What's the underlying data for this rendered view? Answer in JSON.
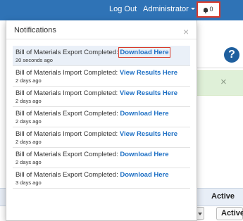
{
  "navbar": {
    "logout_label": "Log Out",
    "user_menu_label": "Administrator",
    "notification_count": "0"
  },
  "background": {
    "help_label": "?",
    "alert_close_label": "×",
    "column_active_header": "Active",
    "active_filter_label": "Active"
  },
  "notifications": {
    "title": "Notifications",
    "close_label": "×",
    "items": [
      {
        "message": "Bill of Materials Export Completed: ",
        "link": "Download Here",
        "time": "20 seconds ago"
      },
      {
        "message": "Bill of Materials Import Completed: ",
        "link": "View Results Here",
        "time": "2 days ago"
      },
      {
        "message": "Bill of Materials Import Completed: ",
        "link": "View Results Here",
        "time": "2 days ago"
      },
      {
        "message": "Bill of Materials Export Completed: ",
        "link": "Download Here",
        "time": "2 days ago"
      },
      {
        "message": "Bill of Materials Import Completed: ",
        "link": "View Results Here",
        "time": "2 days ago"
      },
      {
        "message": "Bill of Materials Export Completed: ",
        "link": "Download Here",
        "time": "2 days ago"
      },
      {
        "message": "Bill of Materials Export Completed: ",
        "link": "Download Here",
        "time": "3 days ago"
      }
    ]
  },
  "colors": {
    "navbar_bg": "#2f73b6",
    "link": "#1d6fc4",
    "highlight_outline": "#d93a2b",
    "alert_success_bg": "#dff0d8"
  }
}
